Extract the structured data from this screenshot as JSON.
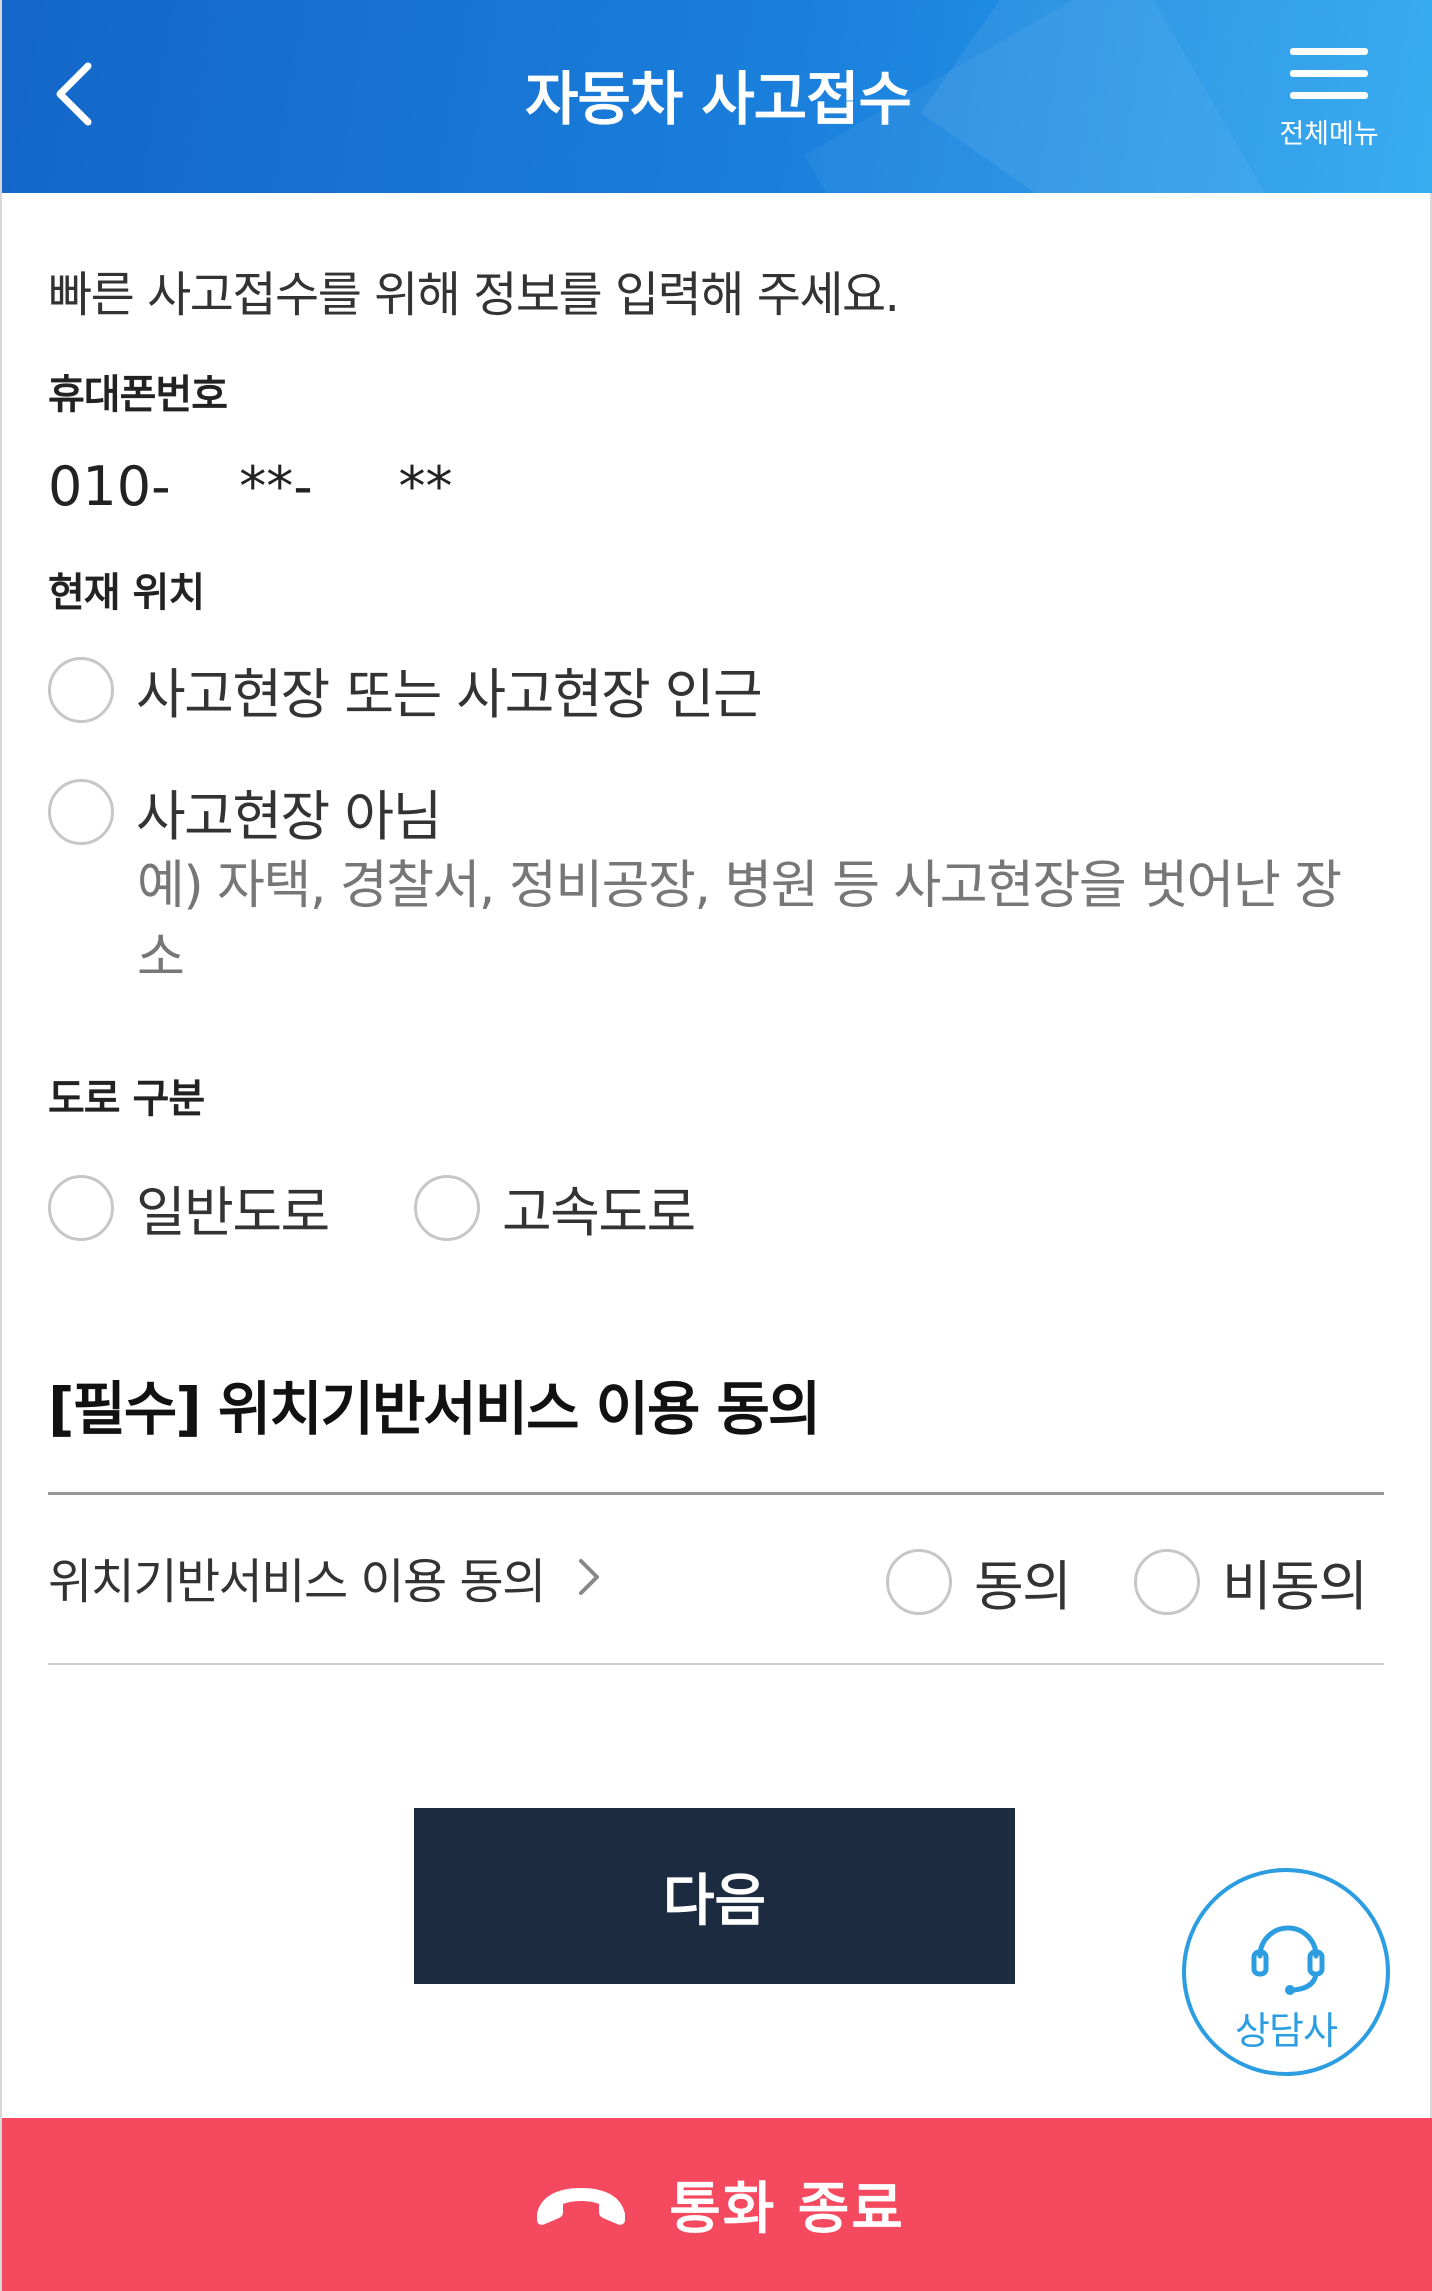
{
  "header": {
    "title": "자동차 사고접수",
    "menu_label": "전체메뉴"
  },
  "intro": "빠른 사고접수를 위해 정보를 입력해 주세요.",
  "phone": {
    "label": "휴대폰번호",
    "value": "010-    **-     **"
  },
  "location": {
    "label": "현재 위치",
    "options": [
      {
        "label": "사고현장 또는 사고현장 인근"
      },
      {
        "label": "사고현장 아님",
        "description": "예) 자택, 경찰서, 정비공장, 병원 등 사고현장을 벗어난 장소"
      }
    ]
  },
  "road": {
    "label": "도로 구분",
    "options": [
      {
        "label": "일반도로"
      },
      {
        "label": "고속도로"
      }
    ]
  },
  "consent": {
    "section_title": "[필수] 위치기반서비스 이용 동의",
    "item_label": "위치기반서비스 이용 동의",
    "agree_label": "동의",
    "disagree_label": "비동의"
  },
  "buttons": {
    "next": "다음",
    "counselor": "상담사",
    "end_call": "통화 종료"
  },
  "colors": {
    "header_blue": "#1a7fdc",
    "next_button": "#1d2b40",
    "end_call": "#f4495f",
    "counselor_accent": "#2b9de0"
  }
}
